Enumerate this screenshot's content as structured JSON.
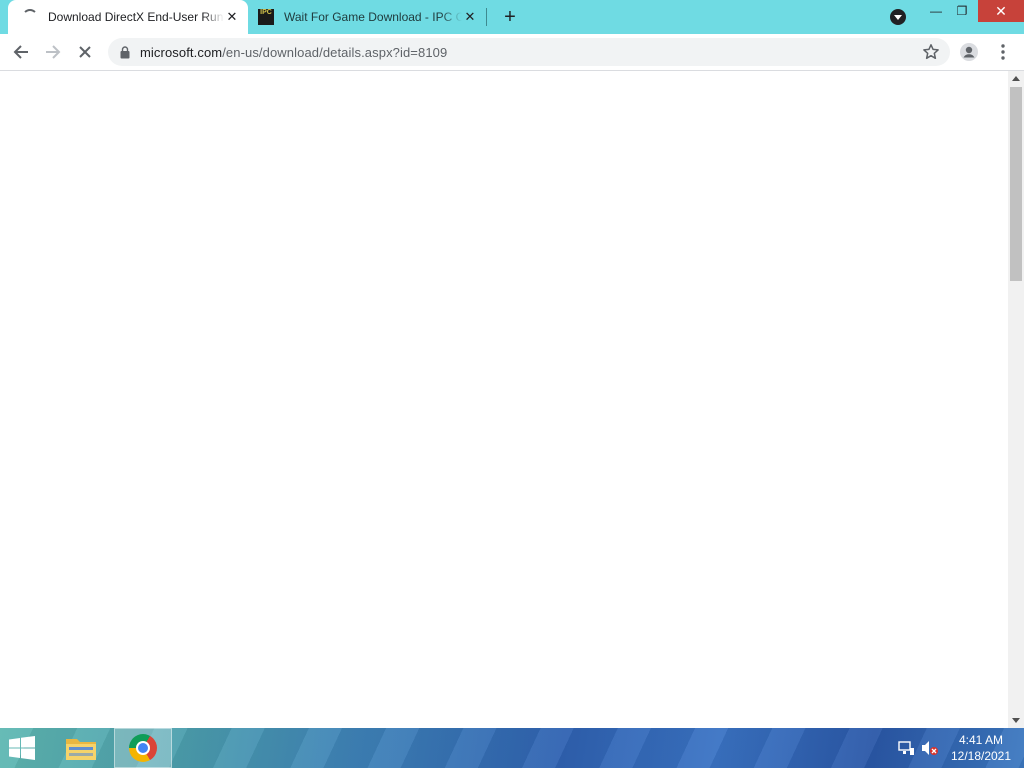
{
  "browser": {
    "tabs": [
      {
        "title": "Download DirectX End-User Runtime Web Installer",
        "active": true,
        "favicon": "loading-spinner-icon",
        "close_label": "✕"
      },
      {
        "title": "Wait For Game Download - IPC Games",
        "active": false,
        "favicon": "ipc-games-icon",
        "favicon_text": "IPC",
        "close_label": "✕"
      }
    ],
    "new_tab_label": "+",
    "window_controls": {
      "minimize": "—",
      "maximize": "❐",
      "close": "✕"
    },
    "address_bar": {
      "domain": "microsoft.com",
      "path": "/en-us/download/details.aspx?id=8109",
      "secure": true
    },
    "loading": true
  },
  "page": {
    "content": ""
  },
  "taskbar": {
    "pinned_apps": [
      "file-explorer",
      "google-chrome"
    ],
    "active_app": "google-chrome",
    "clock": {
      "time": "4:41 AM",
      "date": "12/18/2021"
    }
  },
  "colors": {
    "tabstrip": "#6fdbe3",
    "close_button": "#c7423a",
    "taskbar": "#3e82b8"
  }
}
